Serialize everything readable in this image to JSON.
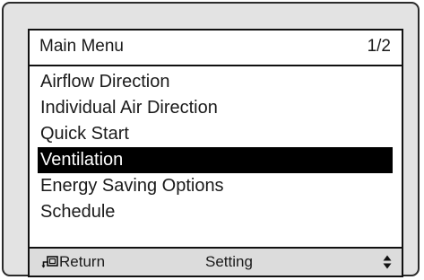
{
  "header": {
    "title": "Main Menu",
    "page": "1/2"
  },
  "menu": {
    "items": [
      {
        "label": "Airflow Direction",
        "selected": false
      },
      {
        "label": "Individual Air Direction",
        "selected": false
      },
      {
        "label": "Quick Start",
        "selected": false
      },
      {
        "label": "Ventilation",
        "selected": true
      },
      {
        "label": "Energy Saving Options",
        "selected": false
      },
      {
        "label": "Schedule",
        "selected": false
      }
    ]
  },
  "footer": {
    "return_label": "Return",
    "return_icon": "return-icon",
    "setting_label": "Setting",
    "scroll_icon": "up-down-arrows-icon"
  }
}
